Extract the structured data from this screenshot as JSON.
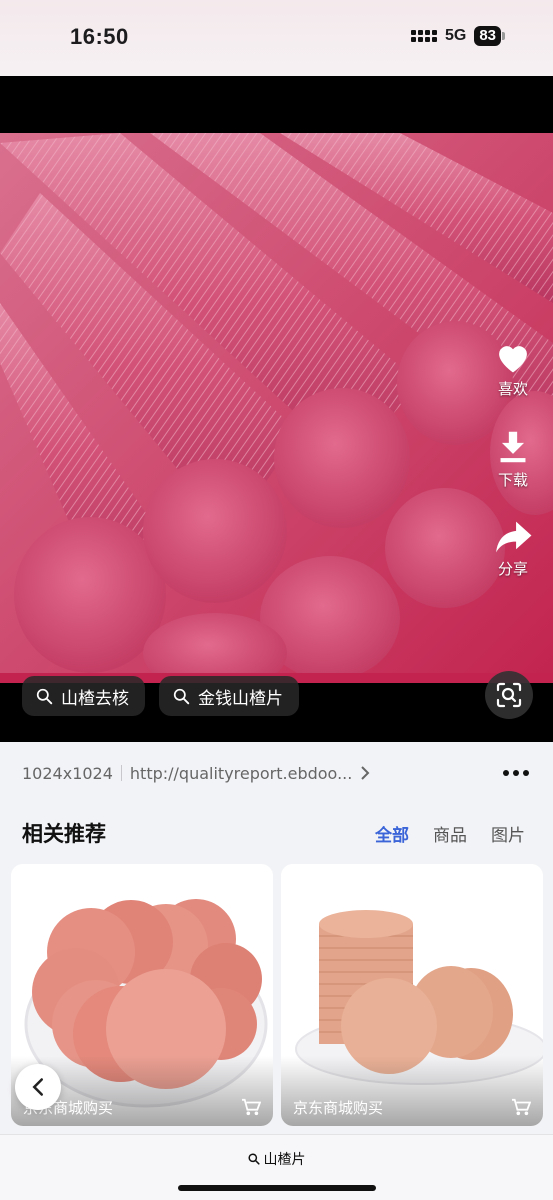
{
  "status_bar": {
    "time": "16:50",
    "network": "5G",
    "battery": "83"
  },
  "side_actions": {
    "like": "喜欢",
    "download": "下载",
    "share": "分享"
  },
  "chips": [
    "山楂去核",
    "金钱山楂片"
  ],
  "info": {
    "dimensions": "1024x1024",
    "url": "http://qualityreport.ebdoo..."
  },
  "related": {
    "title": "相关推荐",
    "tabs": [
      "全部",
      "商品",
      "图片"
    ],
    "cards": [
      {
        "caption": "京东商城购买"
      },
      {
        "caption": "京东商城购买"
      }
    ]
  },
  "bottom": {
    "search_text": "山楂片"
  },
  "colors": {
    "accent": "#3a64d8",
    "viewer_bg": "#000000",
    "chip_bg": "#282828"
  },
  "icons": [
    "heart-icon",
    "download-icon",
    "share-icon",
    "search-icon",
    "lens-icon",
    "more-icon",
    "cart-icon",
    "chevron-left-icon",
    "chevron-right-icon"
  ]
}
